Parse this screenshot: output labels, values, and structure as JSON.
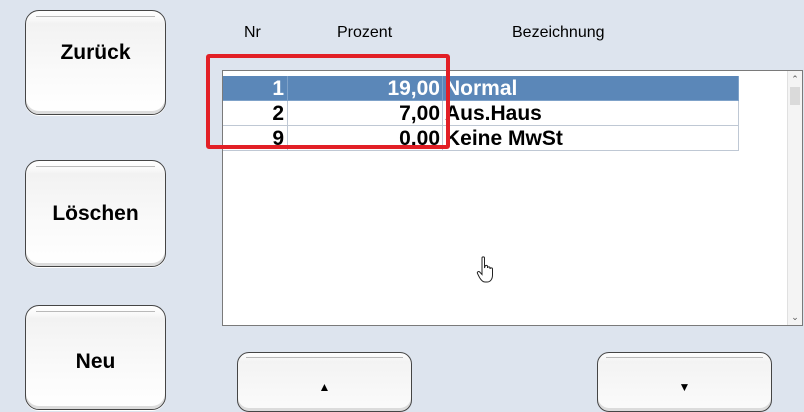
{
  "left_buttons": {
    "back": "Zurück",
    "delete": "Löschen",
    "new": "Neu"
  },
  "table": {
    "columns": [
      "Nr",
      "Prozent",
      "Bezeichnung"
    ],
    "rows": [
      {
        "nr": "1",
        "percent": "19,00",
        "name": "Normal",
        "selected": true
      },
      {
        "nr": "2",
        "percent": "7,00",
        "name": "Aus.Haus",
        "selected": false
      },
      {
        "nr": "9",
        "percent": "0,00",
        "name": "Keine MwSt",
        "selected": false
      }
    ]
  },
  "nav_buttons": {
    "up_icon": "arrow-up-icon",
    "up_glyph": "▲",
    "down_icon": "arrow-down-icon",
    "down_glyph": "▼"
  },
  "colors": {
    "background": "#dde4ee",
    "selection": "#5b87b8",
    "highlight": "#e21f26"
  }
}
